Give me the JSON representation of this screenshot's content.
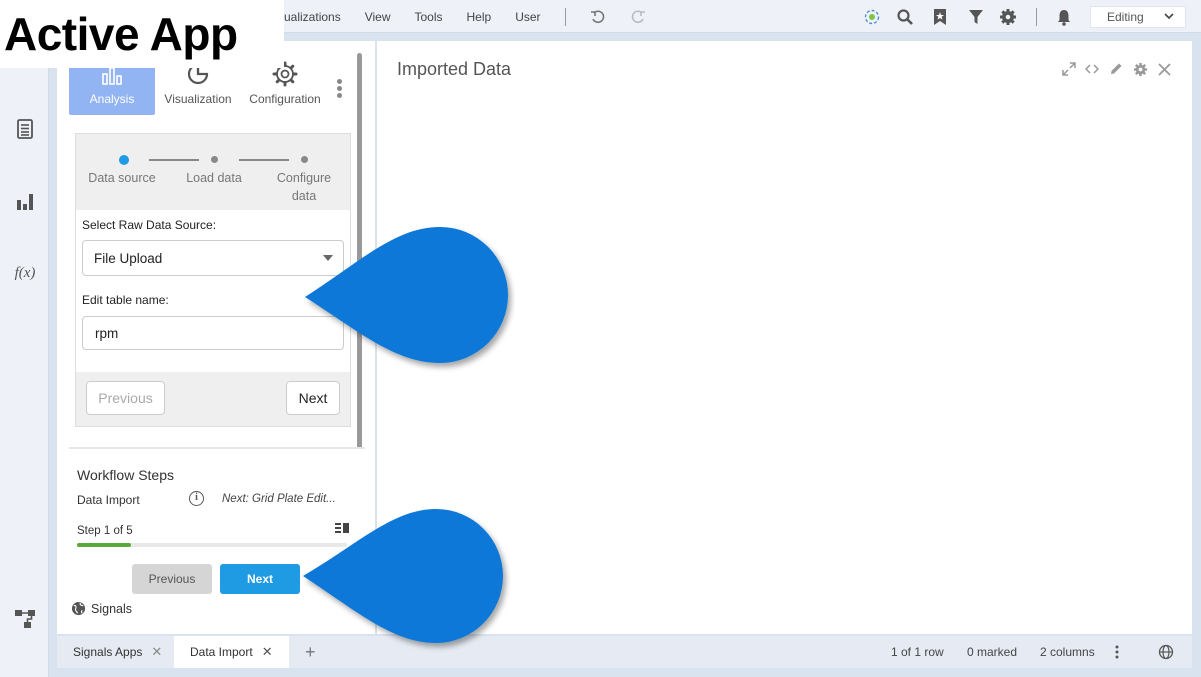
{
  "banner": {
    "text": "Active App"
  },
  "menu": {
    "items": [
      "sualizations",
      "View",
      "Tools",
      "Help",
      "User"
    ],
    "mode": "Editing"
  },
  "left_panel": {
    "tabs": [
      {
        "label": "Analysis",
        "active": true
      },
      {
        "label": "Visualization",
        "active": false
      },
      {
        "label": "Configuration",
        "active": false
      }
    ],
    "wizard": {
      "steps": [
        {
          "label": "Data source",
          "active": true
        },
        {
          "label": "Load data",
          "active": false
        },
        {
          "label": "Configure data",
          "active": false
        }
      ],
      "source_label": "Select Raw Data Source:",
      "source_value": "File Upload",
      "table_label": "Edit table name:",
      "table_value": "rpm",
      "previous": "Previous",
      "next": "Next"
    },
    "workflow": {
      "title": "Workflow Steps",
      "item": "Data Import",
      "next_hint": "Next: Grid Plate Edit...",
      "step_text": "Step 1 of 5",
      "progress_fraction": 0.2,
      "previous": "Previous",
      "next": "Next"
    },
    "signals": "Signals"
  },
  "right_panel": {
    "title": "Imported Data"
  },
  "bottom": {
    "tabs": [
      {
        "label": "Signals Apps",
        "active": false
      },
      {
        "label": "Data Import",
        "active": true
      }
    ],
    "rows": "1 of 1 row",
    "marked": "0 marked",
    "columns": "2 columns"
  },
  "colors": {
    "accent": "#93b4f3",
    "primary_button": "#1e9be3",
    "progress": "#5aa83a",
    "callout": "#0a78d7"
  }
}
